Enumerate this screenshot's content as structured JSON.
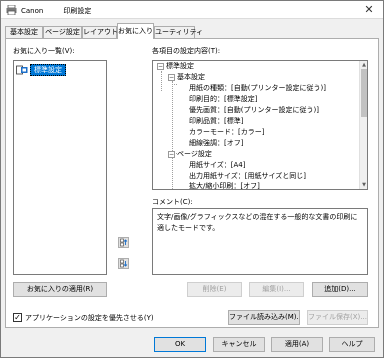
{
  "window": {
    "title": "Canon         印刷設定",
    "close_glyph": "✕"
  },
  "tabs": [
    {
      "label": "基本設定"
    },
    {
      "label": "ページ設定"
    },
    {
      "label": "レイアウト"
    },
    {
      "label": "お気に入り"
    },
    {
      "label": "ユーティリティ"
    }
  ],
  "favorites": {
    "label": "お気に入り一覧(V):",
    "items": [
      "標準設定"
    ],
    "apply_button": "お気に入りの適用(R)"
  },
  "settings": {
    "label": "各項目の設定内容(T):",
    "tree": [
      {
        "text": "標準設定",
        "expander": "−"
      },
      {
        "text": "基本設定",
        "expander": "−"
      },
      {
        "text": "用紙の種類：[自動(プリンター設定に従う)]"
      },
      {
        "text": "印刷目的：[標準設定]"
      },
      {
        "text": "優先画質：[自動(プリンター設定に従う)]"
      },
      {
        "text": "印刷品質：[標準]"
      },
      {
        "text": "カラーモード：[カラー]"
      },
      {
        "text": "細線強調：[オフ]"
      },
      {
        "text": "ページ設定",
        "expander": "−"
      },
      {
        "text": "用紙サイズ：[A4]"
      },
      {
        "text": "出力用紙サイズ：[用紙サイズと同じ]"
      },
      {
        "text": "拡大/縮小印刷：[オフ]"
      }
    ]
  },
  "comment": {
    "label": "コメント(C):",
    "text": "文字/画像/グラフィックスなどの混在する一般的な文書の印刷に適したモードです。"
  },
  "buttons": {
    "delete": "削除(E)",
    "edit": "編集(I)...",
    "add": "追加(D)...",
    "import": "ファイル読み込み(M)...",
    "save": "ファイル保存(X)...",
    "ok": "OK",
    "cancel": "キャンセル",
    "apply": "適用(A)",
    "help": "ヘルプ"
  },
  "prefer_app": {
    "label": "アプリケーションの設定を優先させる(Y)",
    "checked": true,
    "check_glyph": "✓"
  }
}
